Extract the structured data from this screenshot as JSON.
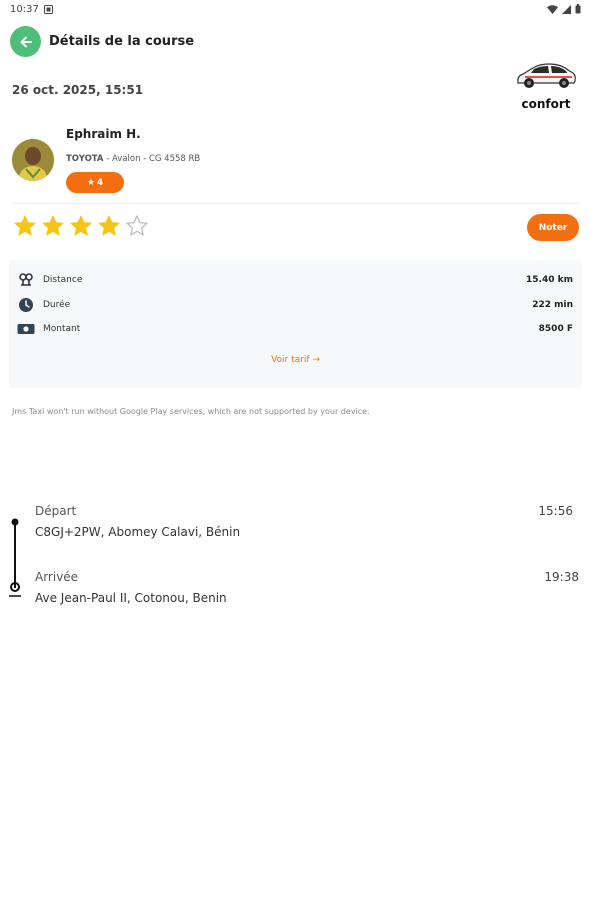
{
  "status_bar": {
    "time": "10:37"
  },
  "header": {
    "title": "Détails de la course"
  },
  "ride": {
    "date": "26 oct. 2025, 15:51",
    "car_class": "confort"
  },
  "driver": {
    "name": "Ephraim H.",
    "vehicle_brand": "TOYOTA",
    "vehicle_details": "- Avalon - CG 4558 RB",
    "rating_badge": "4"
  },
  "rating": {
    "filled_stars": 4,
    "total_stars": 5,
    "button_label": "Noter"
  },
  "stats": {
    "rows": [
      {
        "label": "Distance",
        "value": "15.40 km",
        "icon": "distance-icon"
      },
      {
        "label": "Durée",
        "value": "222 min",
        "icon": "clock-icon"
      },
      {
        "label": "Montant",
        "value": "8500 F",
        "icon": "cash-icon"
      }
    ],
    "tarif_link": "Voir tarif →"
  },
  "notice": "Jms Taxi won't run without Google Play services, which are not supported by your device.",
  "route": {
    "departure": {
      "label": "Départ",
      "address": "C8GJ+2PW, Abomey Calavi, Bénin",
      "time": "15:56"
    },
    "arrival": {
      "label": "Arrivée",
      "address": "Ave Jean-Paul II, Cotonou, Benin",
      "time": "19:38"
    }
  },
  "colors": {
    "accent": "#f36f12",
    "back_button": "#4cbf7a",
    "star": "#f5c518"
  }
}
